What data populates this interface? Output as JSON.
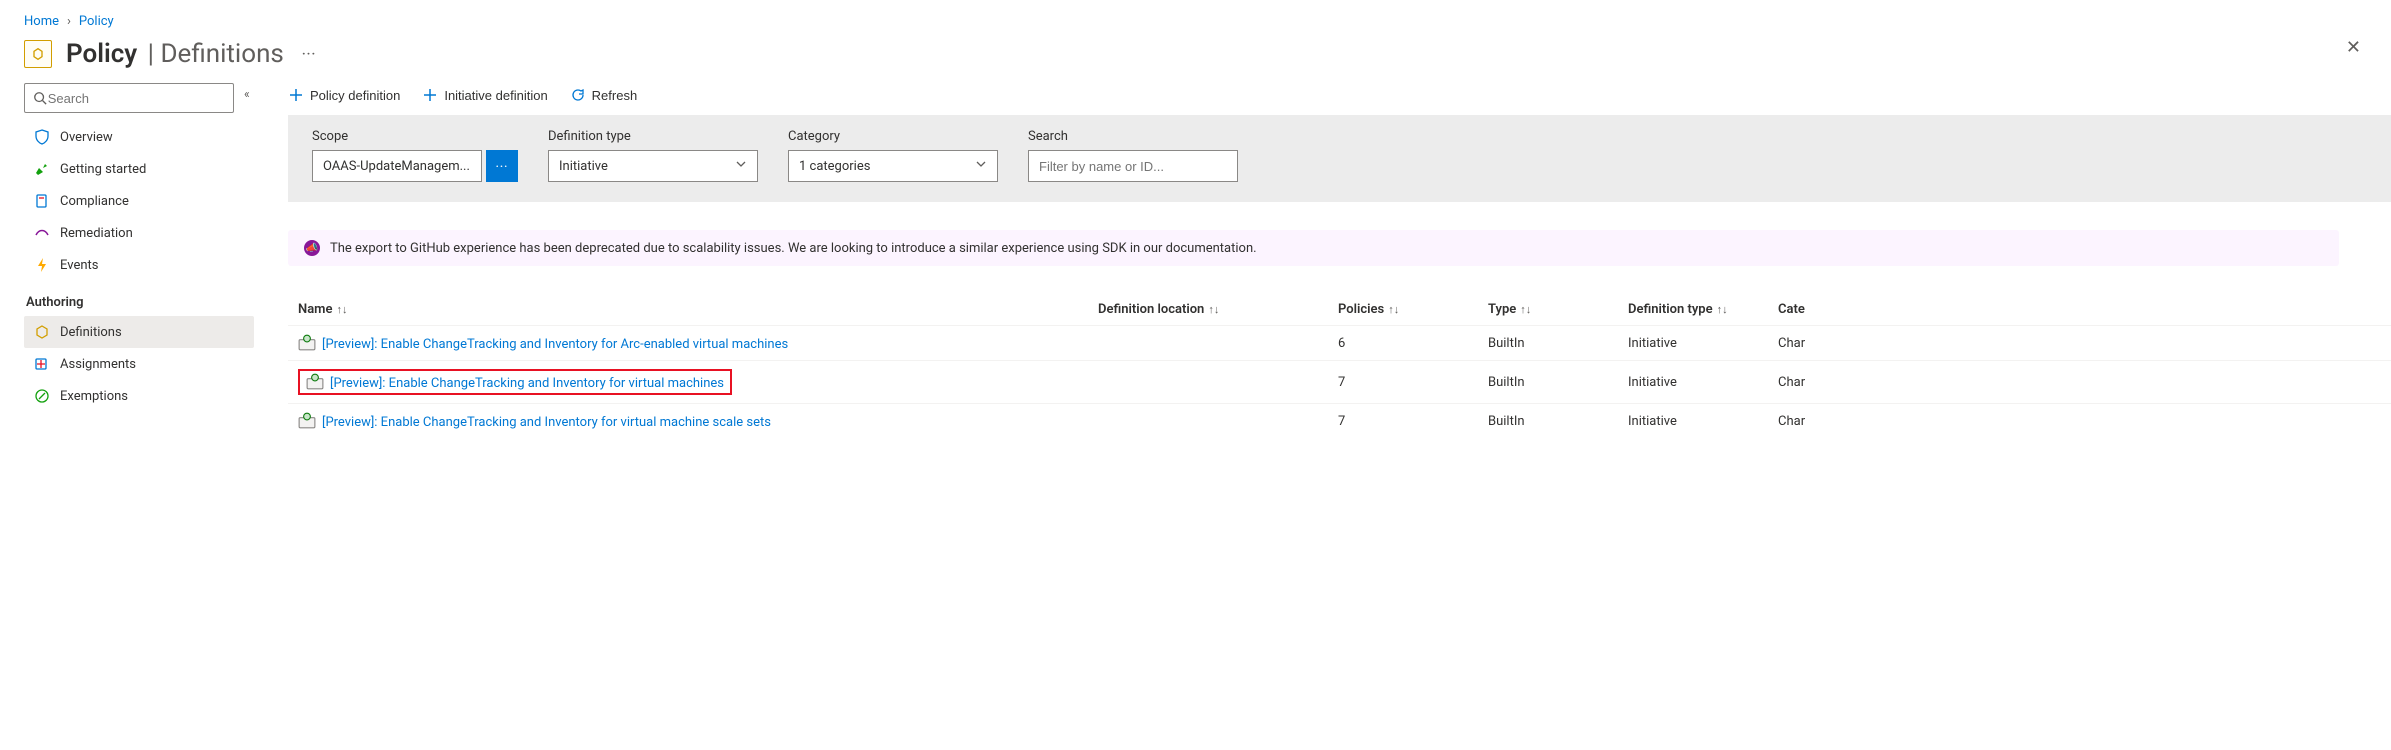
{
  "breadcrumb": {
    "home": "Home",
    "policy": "Policy"
  },
  "header": {
    "title": "Policy",
    "subtitle": "Definitions"
  },
  "sidebar": {
    "search_placeholder": "Search",
    "items": [
      {
        "label": "Overview"
      },
      {
        "label": "Getting started"
      },
      {
        "label": "Compliance"
      },
      {
        "label": "Remediation"
      },
      {
        "label": "Events"
      }
    ],
    "section_authoring": "Authoring",
    "authoring_items": [
      {
        "label": "Definitions",
        "active": true
      },
      {
        "label": "Assignments"
      },
      {
        "label": "Exemptions"
      }
    ]
  },
  "toolbar": {
    "policy_def": "Policy definition",
    "initiative_def": "Initiative definition",
    "refresh": "Refresh"
  },
  "filters": {
    "scope_label": "Scope",
    "scope_value": "OAAS-UpdateManagem...",
    "deftype_label": "Definition type",
    "deftype_value": "Initiative",
    "category_label": "Category",
    "category_value": "1 categories",
    "search_label": "Search",
    "search_placeholder": "Filter by name or ID..."
  },
  "notice": "The export to GitHub experience has been deprecated due to scalability issues. We are looking to introduce a similar experience using SDK in our documentation.",
  "cols": {
    "name": "Name",
    "defloc": "Definition location",
    "policies": "Policies",
    "type": "Type",
    "deftype": "Definition type",
    "category": "Cate"
  },
  "rows": [
    {
      "name": "[Preview]: Enable ChangeTracking and Inventory for Arc-enabled virtual machines",
      "policies": "6",
      "type": "BuiltIn",
      "deftype": "Initiative",
      "category": "Char",
      "highlight": false
    },
    {
      "name": "[Preview]: Enable ChangeTracking and Inventory for virtual machines",
      "policies": "7",
      "type": "BuiltIn",
      "deftype": "Initiative",
      "category": "Char",
      "highlight": true
    },
    {
      "name": "[Preview]: Enable ChangeTracking and Inventory for virtual machine scale sets",
      "policies": "7",
      "type": "BuiltIn",
      "deftype": "Initiative",
      "category": "Char",
      "highlight": false
    }
  ]
}
